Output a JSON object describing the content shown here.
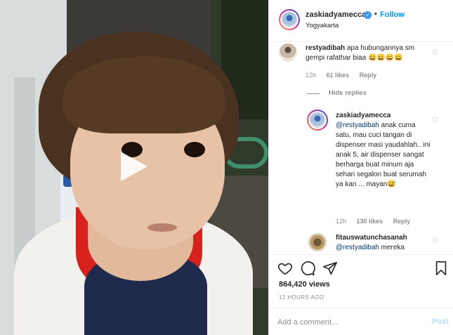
{
  "post": {
    "username": "zaskiadyamecca",
    "dot": "•",
    "follow_label": "Follow",
    "location": "Yogyakarta",
    "more_label": "···"
  },
  "comments": [
    {
      "username": "restyadibah",
      "text": "apa hubungannya sm gempi rafathar biaa 😀😀😀😀",
      "time": "12h",
      "likes": "61 likes",
      "reply_label": "Reply"
    }
  ],
  "hide_replies_label": "Hide replies",
  "reply": {
    "username": "zaskiadyamecca",
    "mention": "@restyadibah",
    "text": "anak cuma satu, mau cuci tangan di dispenser masi yaudahlah.. ini anak 5, air dispenser sangat berharga buat minum aja sehari segalon buat serumah ya kan ... mayan😅",
    "time": "12h",
    "likes": "130 likes",
    "reply_label": "Reply"
  },
  "third_comment": {
    "username": "fitauswatunchasanah",
    "mention": "@restyadibah",
    "text": "mereka"
  },
  "stats": {
    "views": "864,420 views",
    "time": "12 HOURS AGO"
  },
  "add_comment": {
    "placeholder": "Add a comment...",
    "post_label": "Post"
  },
  "icons": {
    "play": "play-icon",
    "heart": "heart-icon",
    "comment": "comment-icon",
    "share": "share-icon",
    "save": "bookmark-icon",
    "verified": "verified-badge-icon"
  },
  "colors": {
    "accent": "#0095f6",
    "post_disabled": "#b2dffc",
    "verified": "#3897f0",
    "muted": "#8e8e8e"
  }
}
